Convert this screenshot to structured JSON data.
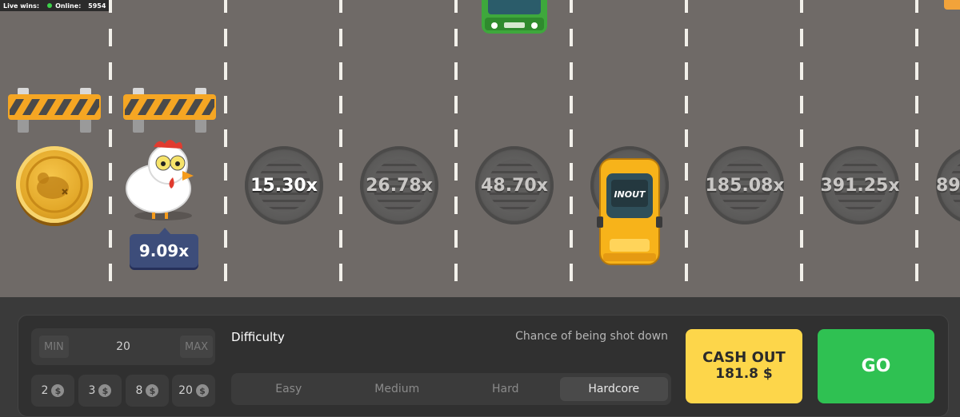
{
  "hud": {
    "live_wins_label": "Live wins:",
    "online_label": "Online:",
    "online_count": "5954"
  },
  "game": {
    "current_multiplier": "9.09x",
    "lanes": [
      {
        "multiplier": "15.30x",
        "active": true
      },
      {
        "multiplier": "26.78x",
        "active": false
      },
      {
        "multiplier": "48.70x",
        "active": false
      },
      {
        "multiplier": "",
        "active": false
      },
      {
        "multiplier": "185.08x",
        "active": false
      },
      {
        "multiplier": "391.25x",
        "active": false
      },
      {
        "multiplier": "89",
        "active": false
      }
    ],
    "taxi_logo": "INOUT"
  },
  "bet": {
    "min_label": "MIN",
    "max_label": "MAX",
    "value": "20",
    "chips": [
      "2",
      "3",
      "8",
      "20"
    ],
    "currency_icon": "$"
  },
  "difficulty": {
    "title": "Difficulty",
    "chance_label": "Chance of being shot down",
    "options": [
      "Easy",
      "Medium",
      "Hard",
      "Hardcore"
    ],
    "selected": "Hardcore"
  },
  "actions": {
    "cashout_label": "CASH OUT",
    "cashout_amount": "181.8 $",
    "go_label": "GO"
  },
  "colors": {
    "road": "#6f6a67",
    "cashout": "#fdd64a",
    "go": "#2fc152",
    "badge": "#3d4d7a"
  }
}
